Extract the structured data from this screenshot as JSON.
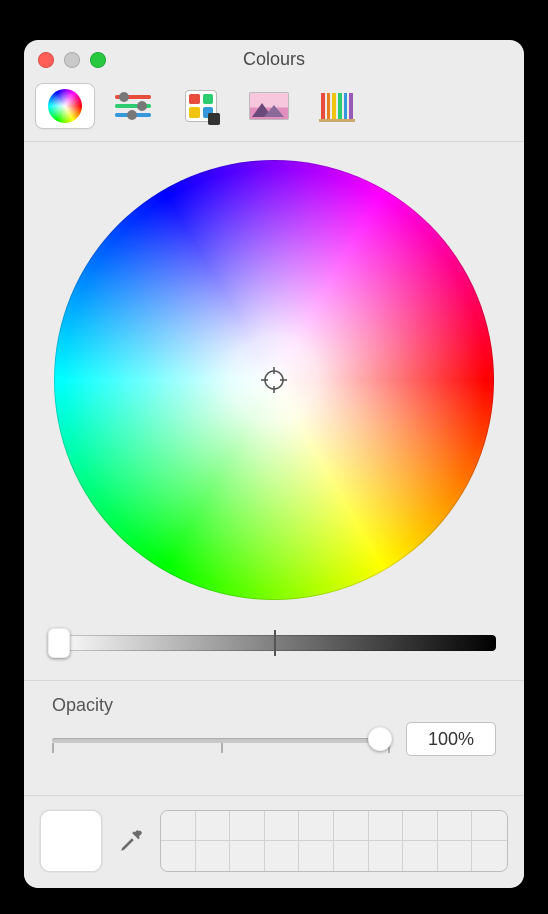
{
  "window": {
    "title": "Colours"
  },
  "tabs": {
    "selected_index": 0,
    "items": [
      {
        "name": "colour-wheel"
      },
      {
        "name": "colour-sliders"
      },
      {
        "name": "colour-palettes"
      },
      {
        "name": "image-palettes"
      },
      {
        "name": "pencils"
      }
    ]
  },
  "wheel": {
    "brightness_percent": 0
  },
  "opacity": {
    "label": "Opacity",
    "value_text": "100%",
    "value_percent": 100
  },
  "current_colour_hex": "#ffffff",
  "swatch_slots": 20
}
